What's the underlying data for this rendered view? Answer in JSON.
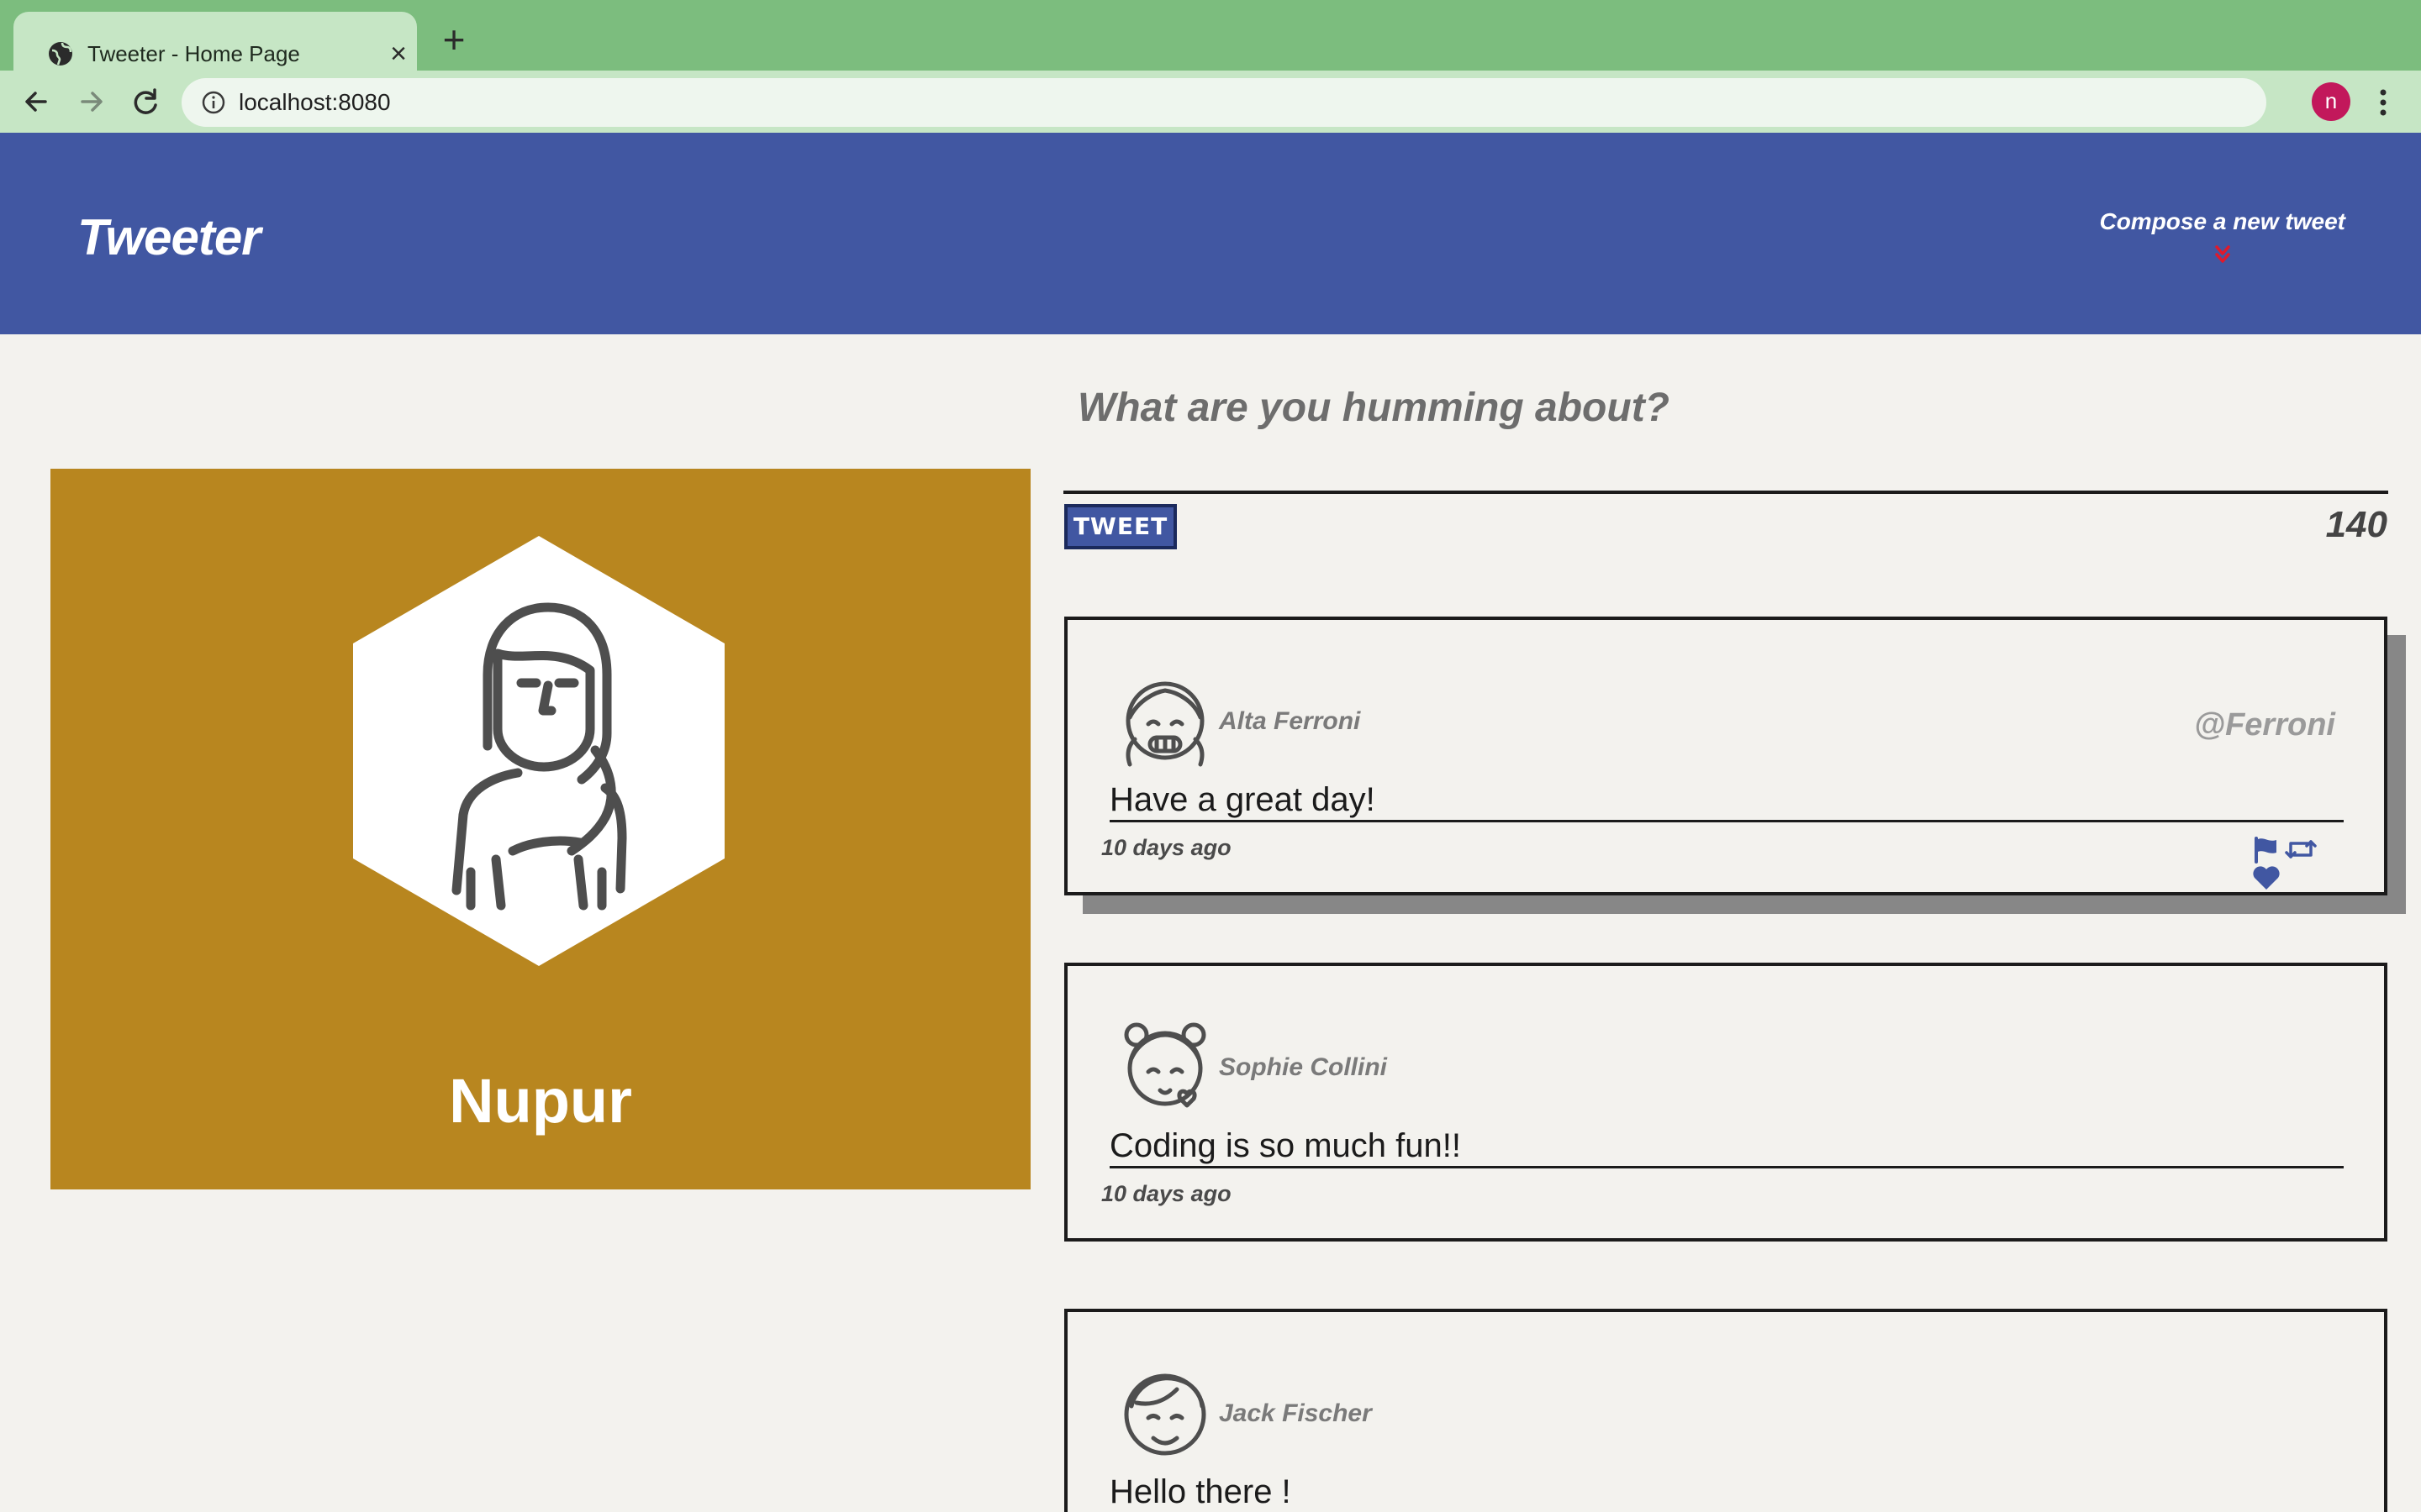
{
  "browser": {
    "tab_title": "Tweeter - Home Page",
    "tab_close": "×",
    "new_tab": "+",
    "url": "localhost:8080",
    "profile_initial": "n"
  },
  "header": {
    "brand": "Tweeter",
    "compose_label": "Compose a new tweet",
    "accent_color": "#4157a2",
    "arrow_color": "#e0192b"
  },
  "profile": {
    "name": "Nupur",
    "background_color": "#b8861f"
  },
  "compose": {
    "placeholder": "What are you humming about?",
    "button_label": "TWEET",
    "char_count": "140"
  },
  "tweets": [
    {
      "name": "Alta Ferroni",
      "handle": "@Ferroni",
      "text": "Have a great day!",
      "time": "10 days ago",
      "avatar_icon": "girl-avatar-icon"
    },
    {
      "name": "Sophie Collini",
      "handle": "",
      "text": "Coding is so much fun!!",
      "time": "10 days ago",
      "avatar_icon": "girl-heart-avatar-icon"
    },
    {
      "name": "Jack Fischer",
      "handle": "",
      "text": "Hello there !",
      "time": "",
      "avatar_icon": "boy-avatar-icon"
    }
  ]
}
